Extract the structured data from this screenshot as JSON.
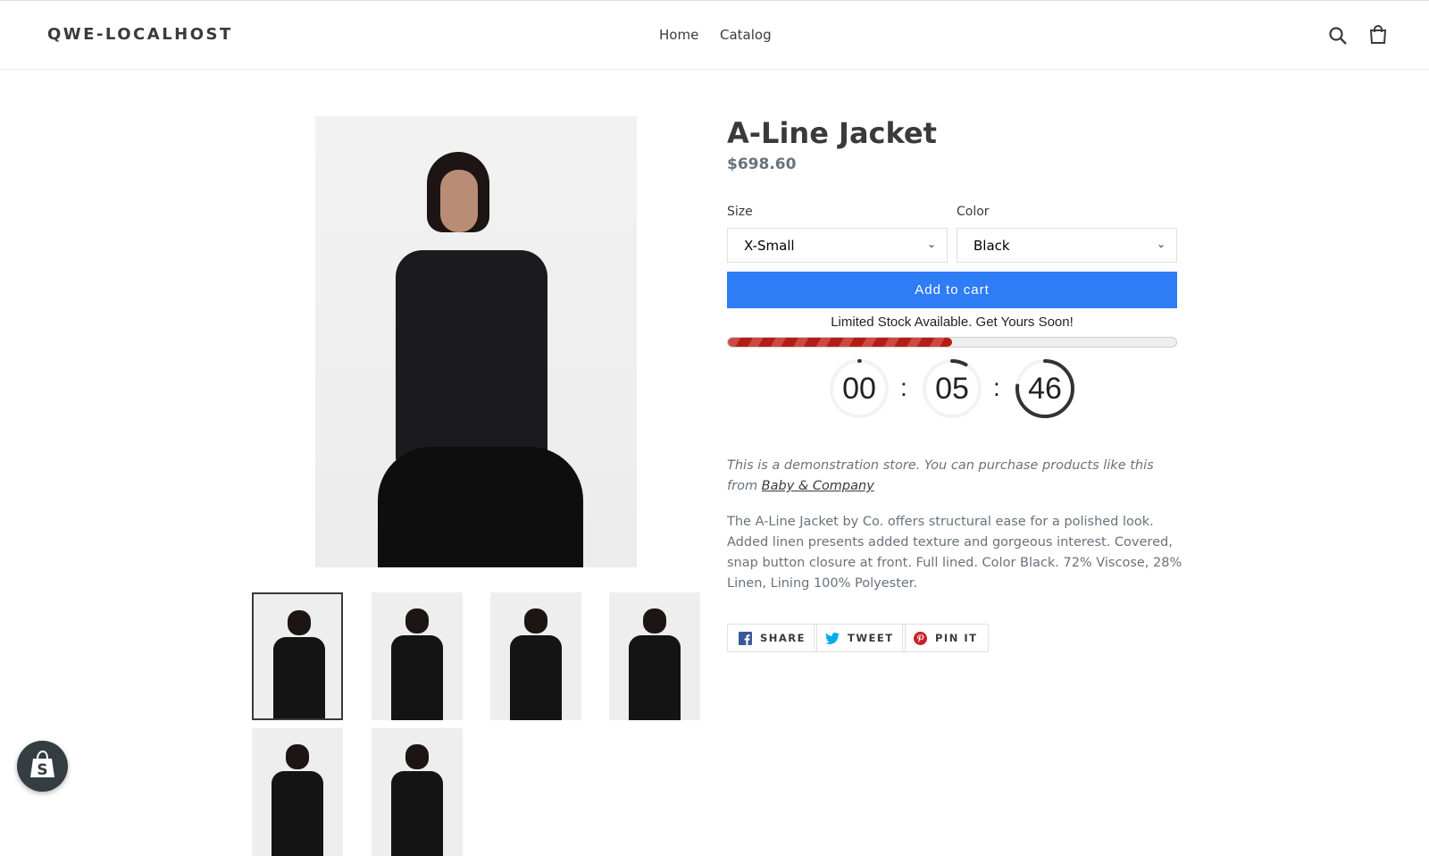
{
  "header": {
    "logo": "QWE-LOCALHOST",
    "nav": [
      {
        "label": "Home"
      },
      {
        "label": "Catalog"
      }
    ],
    "icons": [
      "search-icon",
      "cart-icon"
    ]
  },
  "product": {
    "title": "A-Line Jacket",
    "price": "$698.60",
    "size": {
      "label": "Size",
      "value": "X-Small"
    },
    "color": {
      "label": "Color",
      "value": "Black"
    },
    "add_to_cart": "Add to cart",
    "stock": {
      "message": "Limited Stock Available. Get Yours Soon!",
      "level_percent": 50,
      "fill_color": "#b41d15"
    },
    "timer": {
      "hours": "00",
      "minutes": "05",
      "seconds": "46",
      "colon": ":"
    },
    "demo_text": "This is a demonstration store. You can purchase products like this from",
    "demo_link": "Baby & Company",
    "description": "The A-Line Jacket by Co. offers structural ease for a polished look. Added linen presents added texture and gorgeous interest. Covered, snap button closure at front. Full lined. Color Black. 72% Viscose, 28% Linen, Lining 100% Polyester.",
    "share": [
      {
        "label": "SHARE",
        "icon": "facebook-icon"
      },
      {
        "label": "TWEET",
        "icon": "twitter-icon"
      },
      {
        "label": "PIN IT",
        "icon": "pinterest-icon"
      }
    ],
    "thumbnail_count": 6,
    "selected_thumbnail": 1
  },
  "colors": {
    "accent": "#2e7cf6",
    "stock_bar": "#b41d15",
    "facebook": "#3b5998",
    "twitter": "#00aced",
    "pinterest": "#cb2027"
  }
}
